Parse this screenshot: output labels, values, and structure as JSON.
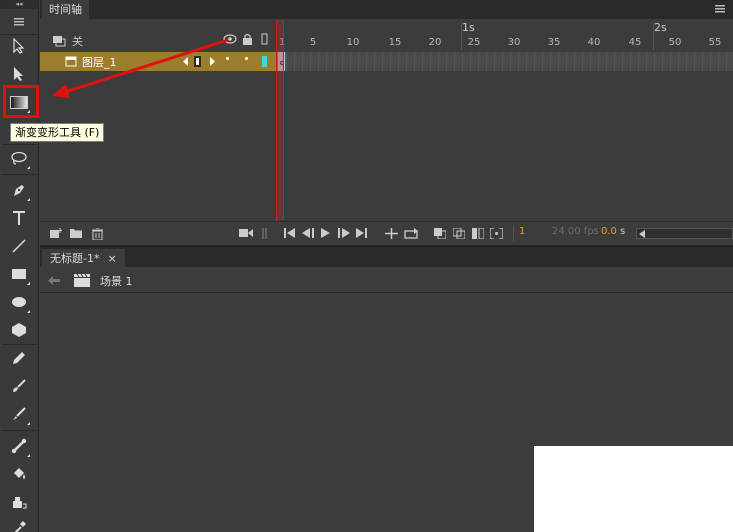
{
  "toolbox": {
    "collapse_glyph": "◂◂",
    "menu_icon": "menu-icon",
    "tools": [
      {
        "name": "selection-tool",
        "icon": "selection-arrow-icon"
      },
      {
        "name": "subselection-tool",
        "icon": "subselection-arrow-icon"
      },
      {
        "name": "gradient-transform-tool",
        "icon": "gradient-transform-icon"
      },
      {
        "name": "lasso-tool",
        "icon": "lasso-icon"
      },
      {
        "name": "pen-tool",
        "icon": "pen-icon"
      },
      {
        "name": "text-tool",
        "icon": "text-icon"
      },
      {
        "name": "line-tool",
        "icon": "line-icon"
      },
      {
        "name": "rectangle-tool",
        "icon": "rectangle-icon"
      },
      {
        "name": "oval-tool",
        "icon": "oval-icon"
      },
      {
        "name": "polystar-tool",
        "icon": "polygon-icon"
      },
      {
        "name": "pencil-tool",
        "icon": "pencil-icon"
      },
      {
        "name": "paint-brush-tool",
        "icon": "paint-brush-icon"
      },
      {
        "name": "brush-tool",
        "icon": "brush-icon"
      },
      {
        "name": "bone-tool",
        "icon": "bone-icon"
      },
      {
        "name": "paint-bucket-tool",
        "icon": "paint-bucket-icon"
      },
      {
        "name": "ink-bottle-tool",
        "icon": "ink-bottle-icon"
      },
      {
        "name": "eyedropper-tool",
        "icon": "eyedropper-icon"
      }
    ],
    "tooltip": "渐变变形工具 (F)"
  },
  "timeline": {
    "tab_label": "时间轴",
    "scene_toggle_label": "关",
    "layer_name": "图层_1",
    "seconds_labels": [
      "1s",
      "2s"
    ],
    "frame_numbers": [
      "1",
      "5",
      "10",
      "15",
      "20",
      "25",
      "30",
      "35",
      "40",
      "45",
      "50",
      "55"
    ],
    "current_frame": "1",
    "fps": "24.00 fps",
    "elapsed": "0.0",
    "elapsed_unit": "s"
  },
  "document": {
    "tab_label": "无标题-1*",
    "tab_close": "×",
    "scene_label": "场景 1"
  },
  "colors": {
    "annotation_red": "#e01010",
    "layer_highlight": "#9c7d2c",
    "playhead": "#c02020",
    "accent_orange": "#e0a030"
  }
}
